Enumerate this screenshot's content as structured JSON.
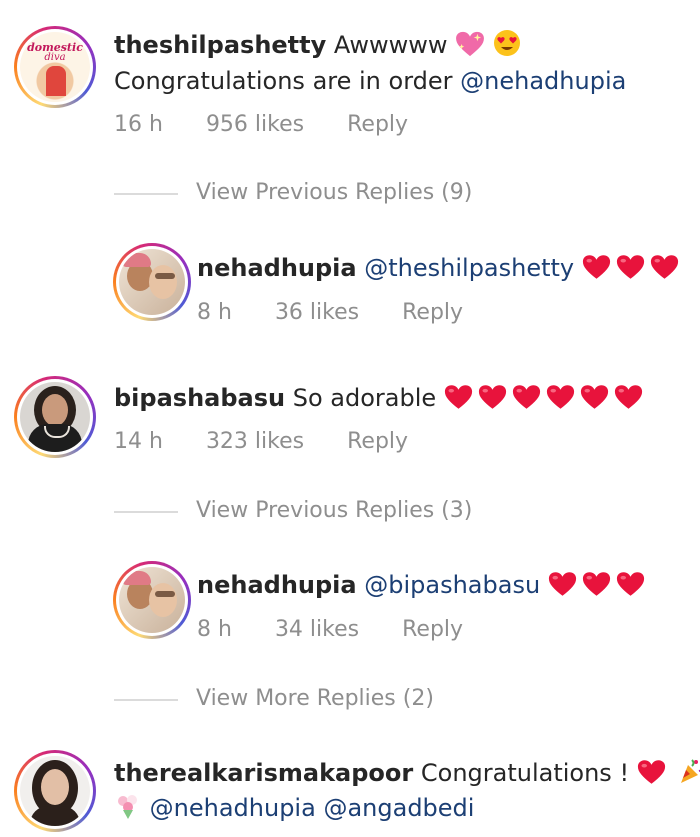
{
  "comments": [
    {
      "username": "theshilpashetty",
      "text": "Awwwww",
      "line2": "Congratulations are in order",
      "mention": "@nehadhupia",
      "time": "16 h",
      "likes": "956 likes",
      "reply": "Reply",
      "avatar_caption_1": "domestic",
      "avatar_caption_2": "diva",
      "view_replies": "View Previous Replies (9)"
    },
    {
      "username": "nehadhupia",
      "mention": "@theshilpashetty",
      "time": "8 h",
      "likes": "36 likes",
      "reply": "Reply"
    },
    {
      "username": "bipashabasu",
      "text": "So adorable",
      "time": "14 h",
      "likes": "323 likes",
      "reply": "Reply",
      "view_replies": "View Previous Replies (3)"
    },
    {
      "username": "nehadhupia",
      "mention": "@bipashabasu",
      "time": "8 h",
      "likes": "34 likes",
      "reply": "Reply",
      "view_more": "View More Replies (2)"
    },
    {
      "username": "therealkarismakapoor",
      "text": "Congratulations !",
      "mention1": "@nehadhupia",
      "mention2": "@angadbedi"
    }
  ],
  "colors": {
    "heart": "#e8133c",
    "mention": "#1c3f74",
    "meta": "#8e8e8e"
  },
  "icons": [
    "sparkling-heart-icon",
    "heart-eyes-emoji-icon",
    "red-heart-icon",
    "party-popper-icon",
    "bouquet-icon"
  ]
}
